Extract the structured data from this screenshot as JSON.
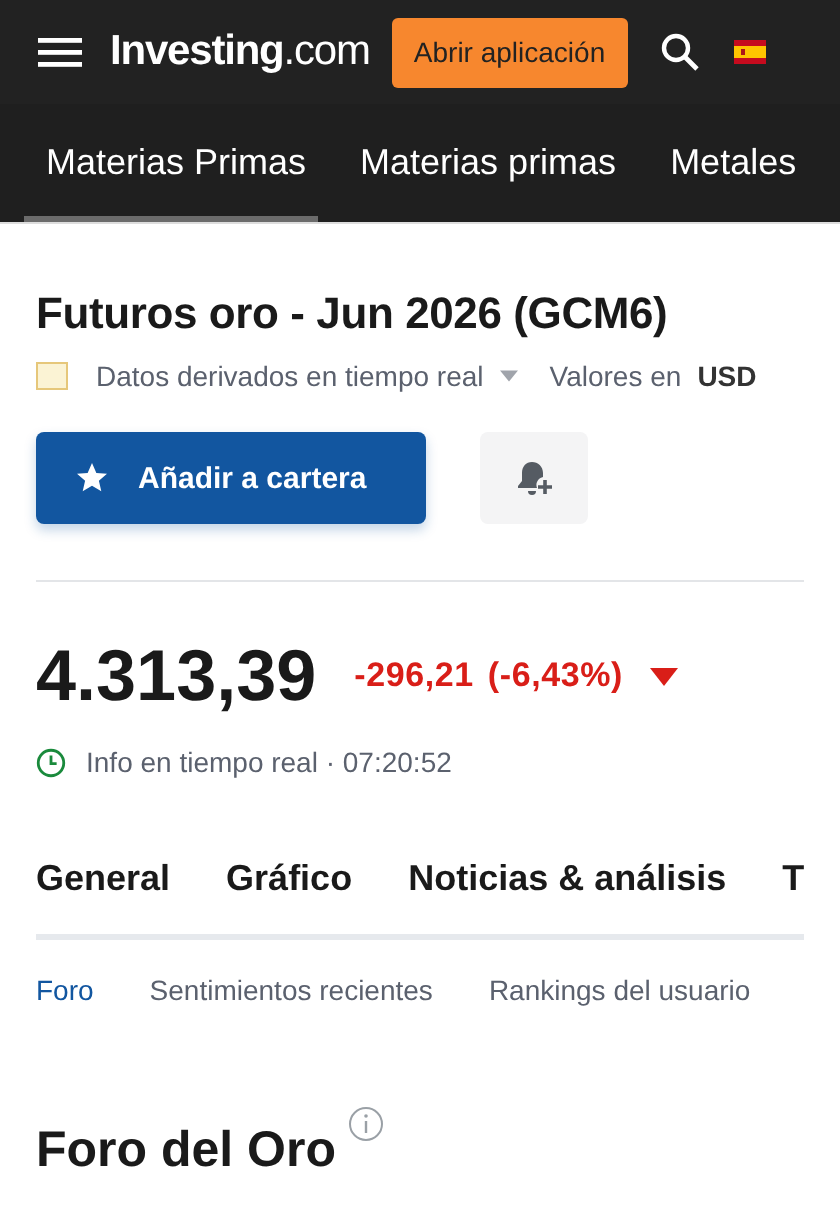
{
  "header": {
    "logo": "**Investing**.com",
    "app_button": "Abrir aplicación"
  },
  "nav_tabs": [
    {
      "label": "Materias Primas",
      "selected": true
    },
    {
      "label": "Materias primas",
      "selected": false
    },
    {
      "label": "Metales",
      "selected": false
    }
  ],
  "instrument": {
    "title": "Futuros oro - Jun 2026 (GCM6)",
    "data_source": "Datos derivados en tiempo real",
    "currency_label": "Valores en",
    "currency": "USD",
    "watchlist_button": "Añadir a cartera"
  },
  "quote": {
    "price": "4.313,39",
    "change": "-296,21",
    "change_percent": "(-6,43%)",
    "falling": true,
    "status": "Info en tiempo real · 07:20:52"
  },
  "section_tabs": [
    {
      "label": "General",
      "selected": false
    },
    {
      "label": "Gráfico",
      "selected": false
    },
    {
      "label": "Noticias & análisis",
      "selected": false
    },
    {
      "label": "T",
      "selected": false
    }
  ],
  "sub_tabs": [
    {
      "label": "Foro",
      "selected": true
    },
    {
      "label": "Sentimientos recientes",
      "selected": false
    },
    {
      "label": "Rankings del usuario",
      "selected": false
    }
  ],
  "forum": {
    "heading": "Foro del Oro"
  }
}
